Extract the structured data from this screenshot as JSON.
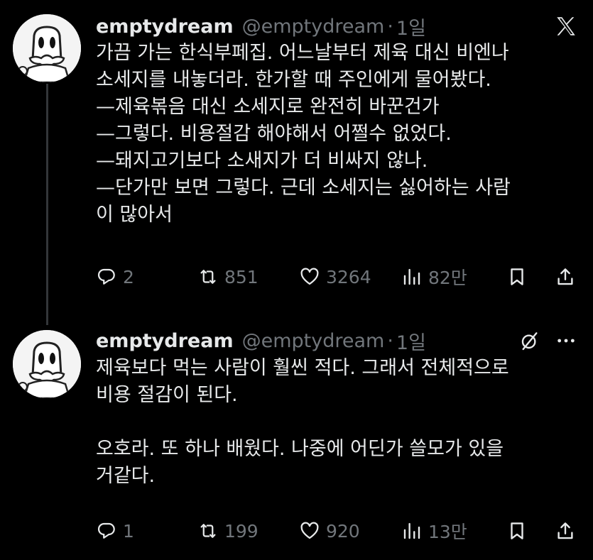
{
  "tweets": [
    {
      "name": "emptydream",
      "handle": "@emptydream",
      "separator": "·",
      "time": "1일",
      "lines": [
        "가끔 가는 한식부페집. 어느날부터 제육 대신 비엔나",
        "소세지를 내놓더라. 한가할 때 주인에게 물어봤다.",
        "—제육볶음 대신 소세지로 완전히 바꾼건가",
        "—그렇다. 비용절감 해야해서 어쩔수 없었다.",
        "—돼지고기보다 소새지가 더 비싸지 않나.",
        "—단가만 보면 그렇다. 근데 소세지는 싫어하는 사람",
        "이 많아서"
      ],
      "stats": {
        "replies": "2",
        "reposts": "851",
        "likes": "3264",
        "views": "82만"
      },
      "top_icon": "x-logo-icon"
    },
    {
      "name": "emptydream",
      "handle": "@emptydream",
      "separator": "·",
      "time": "1일",
      "lines": [
        "제육보다 먹는 사람이 훨씬 적다. 그래서 전체적으로",
        "비용 절감이 된다.",
        "",
        "오호라. 또 하나 배웠다. 나중에 어딘가 쓸모가 있을",
        "거같다."
      ],
      "stats": {
        "replies": "1",
        "reposts": "199",
        "likes": "920",
        "views": "13만"
      },
      "top_icons": [
        "grok-icon",
        "more-icon"
      ]
    }
  ]
}
